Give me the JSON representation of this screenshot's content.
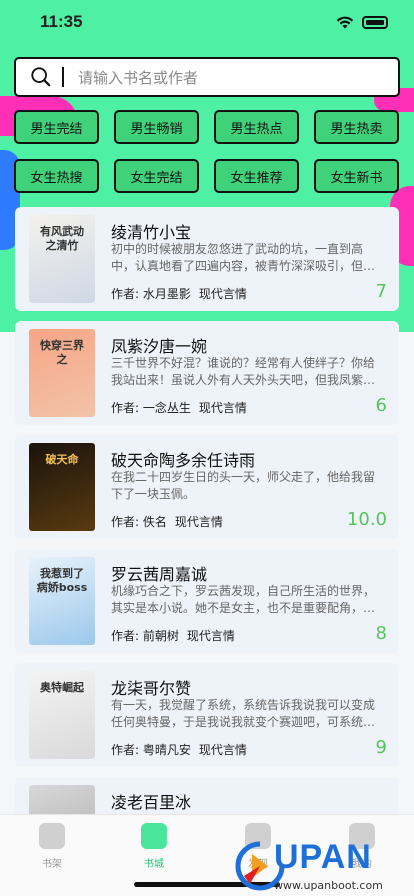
{
  "status": {
    "time": "11:35"
  },
  "search": {
    "placeholder": "请输入书名或作者"
  },
  "categories": [
    "男生完结",
    "男生畅销",
    "男生热点",
    "男生热卖",
    "女生热搜",
    "女生完结",
    "女生推荐",
    "女生新书"
  ],
  "books": [
    {
      "title": "绫清竹小宝",
      "desc": "初中的时候被朋友忽悠进了武动的坑，一直到高中，认真地看了四遍内容，被青竹深深吸引，但不甚喜…",
      "author": "作者: 水月墨影",
      "genre": "现代言情",
      "score": "7",
      "cover_text": "有风武动之清竹",
      "cover_colors": [
        "#f3f1ec",
        "#cfd8e6"
      ]
    },
    {
      "title": "凤紫汐唐一婉",
      "desc": "三千世界不好混？谁说的？经常有人使绊子？你给我站出来！虽说人外有人天外头天吧，但我凤紫汐也…",
      "author": "作者: 一念丛生",
      "genre": "现代言情",
      "score": "6",
      "cover_text": "快穿三界之",
      "cover_colors": [
        "#f7a586",
        "#f2c3a8"
      ]
    },
    {
      "title": "破天命陶多余任诗雨",
      "desc": "在我二十四岁生日的头一天，师父走了，他给我留下了一块玉佩。",
      "author": "作者: 佚名",
      "genre": "现代言情",
      "score": "10.0",
      "cover_text": "破天命",
      "cover_colors": [
        "#1a140c",
        "#5a3a10"
      ]
    },
    {
      "title": "罗云茜周嘉诚",
      "desc": "机缘巧合之下，罗云茜发现，自己所生活的世界，其实是本小说。她不是女主，也不是重要配角，只是…",
      "author": "作者: 前朝树",
      "genre": "现代言情",
      "score": "8",
      "cover_text": "我惹到了病娇boss",
      "cover_colors": [
        "#e7f2fb",
        "#9cc8ec"
      ]
    },
    {
      "title": "龙柒哥尔赞",
      "desc": "有一天，我觉醒了系统，系统告诉我说我可以变成任何奥特曼，于是我说我就变个赛迦吧，可系统却说…",
      "author": "作者: 粤晴凡安",
      "genre": "现代言情",
      "score": "9",
      "cover_text": "奥特崛起",
      "cover_colors": [
        "#f4f4f4",
        "#d9d9d9"
      ]
    },
    {
      "title": "凌老百里冰",
      "desc": "",
      "author": "",
      "genre": "",
      "score": "",
      "cover_text": "",
      "cover_colors": [
        "#d8d8d8",
        "#aaaaaa"
      ]
    }
  ],
  "tabs": [
    {
      "label": "书架",
      "icon": "bookshelf-icon"
    },
    {
      "label": "书城",
      "icon": "bookstore-icon",
      "active": true
    },
    {
      "label": "发现",
      "icon": "discover-icon"
    },
    {
      "label": "我的",
      "icon": "profile-icon"
    }
  ],
  "watermark": {
    "brand": "UPAN",
    "url": "www.upanboot.com"
  }
}
